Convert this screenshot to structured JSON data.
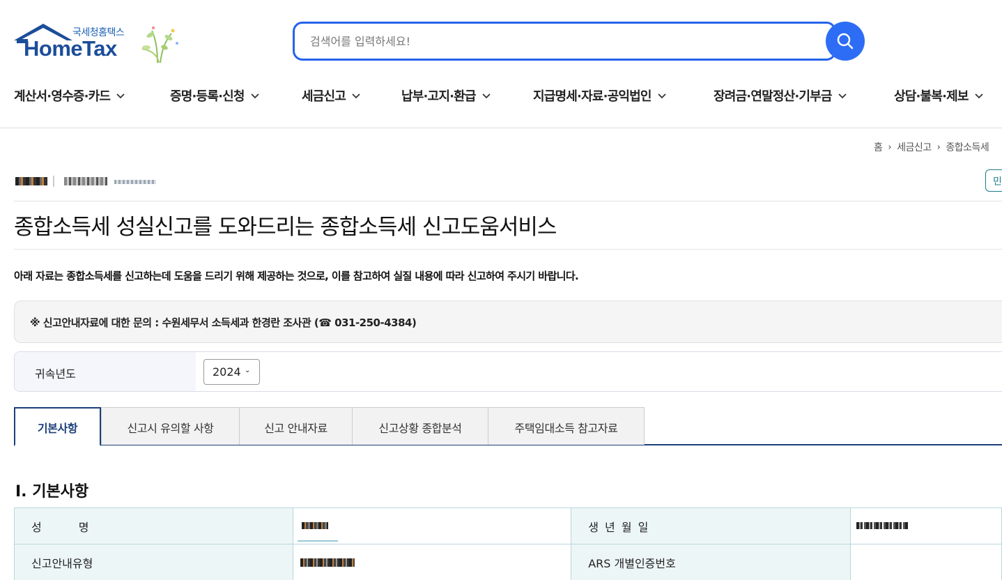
{
  "header": {
    "logo_sub": "국세청홈택스",
    "logo_main": "HomeTax",
    "search_placeholder": "검색어를 입력하세요!"
  },
  "gnb": [
    {
      "label": "계산서·영수증·카드"
    },
    {
      "label": "증명·등록·신청"
    },
    {
      "label": "세금신고"
    },
    {
      "label": "납부·고지·환급"
    },
    {
      "label": "지급명세·자료·공익법인"
    },
    {
      "label": "장려금·연말정산·기부금"
    },
    {
      "label": "상담·불복·제보"
    }
  ],
  "breadcrumb": {
    "home": "홈",
    "level1": "세금신고",
    "level2": "종합소득세"
  },
  "profile_side_button": "민",
  "page_title": "종합소득세 성실신고를 도와드리는 종합소득세 신고도움서비스",
  "notice": "아래 자료는 종합소득세를 신고하는데 도움을 드리기 위해 제공하는 것으로, 이를 참고하여 실질 내용에 따라 신고하여 주시기 바랍니다.",
  "inquiry": "※ 신고안내자료에 대한 문의 : 수원세무서 소득세과 한경란 조사관 (☎ 031-250-4384)",
  "year_filter": {
    "label": "귀속년도",
    "selected": "2024"
  },
  "tabs": [
    {
      "label": "기본사항",
      "active": true
    },
    {
      "label": "신고시 유의할 사항",
      "active": false
    },
    {
      "label": "신고 안내자료",
      "active": false
    },
    {
      "label": "신고상황 종합분석",
      "active": false
    },
    {
      "label": "주택임대소득 참고자료",
      "active": false
    }
  ],
  "section_title": "Ⅰ. 기본사항",
  "basic_info": {
    "name_label": "성 명",
    "birth_label": "생 년 월 일",
    "type_label": "신고안내유형",
    "ars_label": "ARS 개별인증번호"
  },
  "colors": {
    "accent": "#2563eb",
    "brand": "#1b4e9a",
    "tab_active": "#1b3f7a",
    "table_border": "#b9d6dc",
    "table_header_bg": "#edf6f6"
  }
}
